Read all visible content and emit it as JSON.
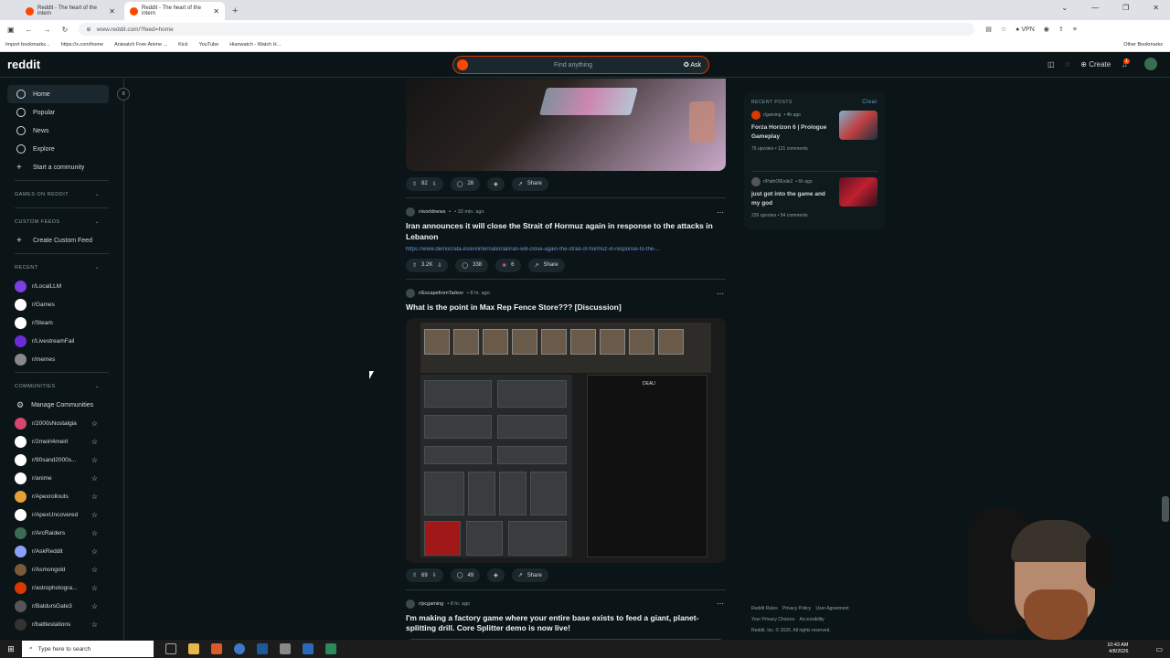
{
  "browser": {
    "tabs": [
      {
        "title": "Reddit - The heart of the intern"
      },
      {
        "title": "Reddit - The heart of the intern"
      }
    ],
    "url": "www.reddit.com/?feed=home",
    "vpn_label": "VPN",
    "bookmarks": [
      "Import bookmarks...",
      "https://x.com/home",
      "Aniwatch Free Anime ...",
      "Kick",
      "YouTube",
      "Hianwatch - Watch H..."
    ],
    "other_bookmarks": "Other Bookmarks"
  },
  "header": {
    "logo": "reddit",
    "search_placeholder": "Find anything",
    "ask_label": "Ask",
    "create_label": "Create",
    "notification_count": "1"
  },
  "sidebar": {
    "nav": [
      {
        "label": "Home",
        "icon": "home-icon"
      },
      {
        "label": "Popular",
        "icon": "popular-icon"
      },
      {
        "label": "News",
        "icon": "news-icon"
      },
      {
        "label": "Explore",
        "icon": "explore-icon"
      },
      {
        "label": "Start a community",
        "icon": "plus-icon"
      }
    ],
    "games_heading": "GAMES ON REDDIT",
    "custom_feeds_heading": "CUSTOM FEEDS",
    "create_custom_feed": "Create Custom Feed",
    "recent_heading": "RECENT",
    "recent": [
      {
        "name": "r/LocalLLM",
        "color": "#7b3fe4"
      },
      {
        "name": "r/Games",
        "color": "#ffffff"
      },
      {
        "name": "r/Steam",
        "color": "#ffffff"
      },
      {
        "name": "r/LivestreamFail",
        "color": "#6a2bd8"
      },
      {
        "name": "r/memes",
        "color": "#888888"
      }
    ],
    "communities_heading": "COMMUNITIES",
    "manage_communities": "Manage Communities",
    "communities": [
      {
        "name": "r/2000sNostalgia",
        "color": "#d3486c"
      },
      {
        "name": "r/2meirl4meirl",
        "color": "#ffffff"
      },
      {
        "name": "r/90sand2000s...",
        "color": "#ffffff"
      },
      {
        "name": "r/anime",
        "color": "#ffffff"
      },
      {
        "name": "r/Apexrollouts",
        "color": "#e8a03a"
      },
      {
        "name": "r/ApexUncovered",
        "color": "#ffffff"
      },
      {
        "name": "r/ArcRaiders",
        "color": "#3a6b54"
      },
      {
        "name": "r/AskReddit",
        "color": "#8aa0ff"
      },
      {
        "name": "r/Asmongold",
        "color": "#7a5a3a"
      },
      {
        "name": "r/astrophotogra...",
        "color": "#d93900"
      },
      {
        "name": "r/BaldursGate3",
        "color": "#555555"
      },
      {
        "name": "r/battlestations",
        "color": "#333333"
      }
    ]
  },
  "feed": {
    "post0": {
      "upvotes": "82",
      "comments": "28",
      "share": "Share"
    },
    "post1": {
      "subreddit": "r/worldnews",
      "time": "32 min. ago",
      "title": "Iran announces it will close the Strait of Hormuz again in response to the attacks in Lebanon",
      "link": "https://www.democrata.es/en/international/iran-will-close-again-the-strait-of-hormuz-in-response-to-the-...",
      "upvotes": "3.2K",
      "comments": "338",
      "awards": "6",
      "share": "Share"
    },
    "post2": {
      "subreddit": "r/EscapefromTarkov",
      "time": "8 hr. ago",
      "title": "What is the point in Max Rep Fence Store??? [Discussion]",
      "upvotes": "69",
      "comments": "49",
      "share": "Share",
      "game_deal": "DEAL!"
    },
    "post3": {
      "subreddit": "r/pcgaming",
      "time": "8 hr. ago",
      "title": "I'm making a factory game where your entire base exists to feed a giant, planet-splitting drill. Core Splitter demo is now live!"
    }
  },
  "recent_posts": {
    "heading": "RECENT POSTS",
    "clear": "Clear",
    "items": [
      {
        "subreddit": "r/gaming",
        "time": "4h ago",
        "title": "Forza Horizon 6 | Prologue Gameplay",
        "upvotes": "75 upvotes",
        "comments": "121 comments"
      },
      {
        "subreddit": "r/PathOfExile2",
        "time": "6h ago",
        "title": "just got into the game and my god",
        "upvotes": "226 upvotes",
        "comments": "54 comments"
      }
    ]
  },
  "footer": {
    "links": [
      "Reddit Rules",
      "Privacy Policy",
      "User Agreement",
      "Your Privacy Choices",
      "Accessibility"
    ],
    "copyright": "Reddit, Inc. © 2026. All rights reserved."
  },
  "taskbar": {
    "search_placeholder": "Type here to search",
    "time": "10:43 AM",
    "date": "4/8/2026"
  }
}
